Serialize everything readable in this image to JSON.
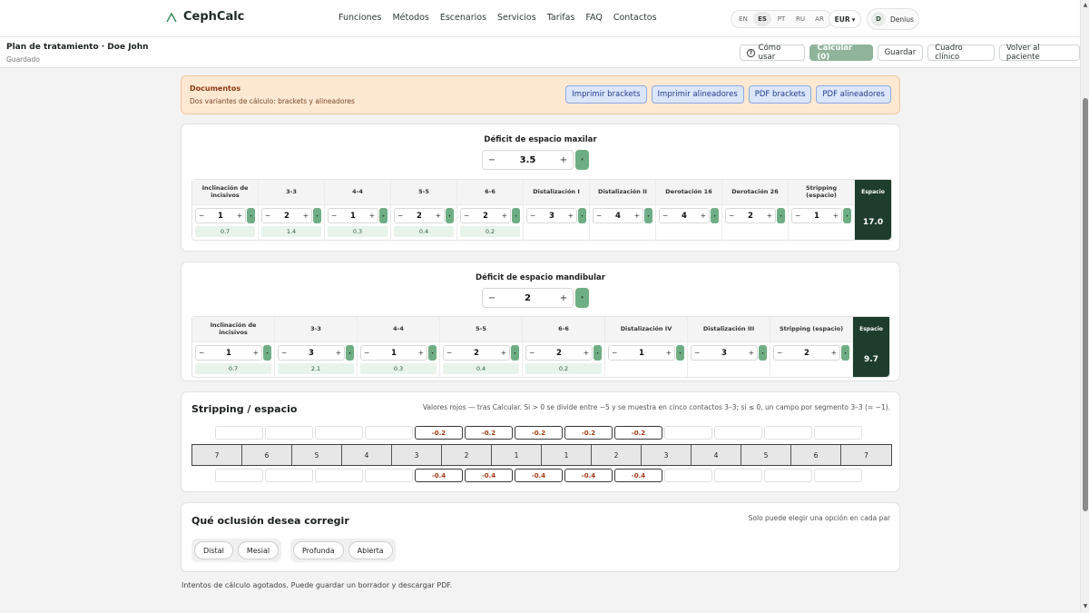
{
  "app": {
    "brand": "CephCalc"
  },
  "nav": [
    "Funciones",
    "Métodos",
    "Escenarios",
    "Servicios",
    "Tarifas",
    "FAQ",
    "Contactos"
  ],
  "languages": [
    "EN",
    "ES",
    "PT",
    "RU",
    "AR"
  ],
  "active_language": "ES",
  "currency": "EUR",
  "user": {
    "initial": "D",
    "name": "Denius"
  },
  "plan": {
    "title": "Plan de tratamiento · Doe John",
    "status": "Guardado"
  },
  "actions": {
    "how": "Cómo usar",
    "calc": "Calcular (0)",
    "save": "Guardar",
    "clinical": "Cuadro clínico",
    "back": "Volver al paciente"
  },
  "documents": {
    "title": "Documentos",
    "subtitle": "Dos variantes de cálculo: brackets y alineadores",
    "buttons": [
      "Imprimir brackets",
      "Imprimir alineadores",
      "PDF brackets",
      "PDF alineadores"
    ]
  },
  "maxilar": {
    "title": "Déficit de espacio maxilar",
    "value": "3.5",
    "columns": [
      {
        "label": "Inclinación de incisivos",
        "value": "1",
        "chip": "0.7"
      },
      {
        "label": "3-3",
        "value": "2",
        "chip": "1.4"
      },
      {
        "label": "4-4",
        "value": "1",
        "chip": "0.3"
      },
      {
        "label": "5-5",
        "value": "2",
        "chip": "0.4"
      },
      {
        "label": "6-6",
        "value": "2",
        "chip": "0.2"
      },
      {
        "label": "Distalización I",
        "value": "3",
        "chip": ""
      },
      {
        "label": "Distalización II",
        "value": "4",
        "chip": ""
      },
      {
        "label": "Derotación 16",
        "value": "4",
        "chip": ""
      },
      {
        "label": "Derotación 26",
        "value": "2",
        "chip": ""
      },
      {
        "label": "Stripping (espacio)",
        "value": "1",
        "chip": ""
      }
    ],
    "space_label": "Espacio",
    "space_value": "17.0"
  },
  "mandibular": {
    "title": "Déficit de espacio mandibular",
    "value": "2",
    "columns": [
      {
        "label": "Inclinación de incisivos",
        "value": "1",
        "chip": "0.7"
      },
      {
        "label": "3-3",
        "value": "3",
        "chip": "2.1"
      },
      {
        "label": "4-4",
        "value": "1",
        "chip": "0.3"
      },
      {
        "label": "5-5",
        "value": "2",
        "chip": "0.4"
      },
      {
        "label": "6-6",
        "value": "2",
        "chip": "0.2"
      },
      {
        "label": "Distalización IV",
        "value": "1",
        "chip": ""
      },
      {
        "label": "Distalización III",
        "value": "3",
        "chip": ""
      },
      {
        "label": "Stripping (espacio)",
        "value": "2",
        "chip": ""
      }
    ],
    "space_label": "Espacio",
    "space_value": "9.7"
  },
  "stripping": {
    "title": "Stripping / espacio",
    "note": "Valores rojos — tras Calcular. Si > 0 se divide entre −5 y se muestra en cinco contactos 3–3; si ≤ 0, un campo por segmento 3–3 (= −1).",
    "upper": [
      "",
      "",
      "",
      "",
      "-0.2",
      "-0.2",
      "-0.2",
      "-0.2",
      "-0.2",
      "",
      "",
      "",
      ""
    ],
    "teeth": [
      "7",
      "6",
      "5",
      "4",
      "3",
      "2",
      "1",
      "1",
      "2",
      "3",
      "4",
      "5",
      "6",
      "7"
    ],
    "lower": [
      "",
      "",
      "",
      "",
      "-0.4",
      "-0.4",
      "-0.4",
      "-0.4",
      "-0.4",
      "",
      "",
      "",
      ""
    ]
  },
  "occlusion": {
    "title": "Qué oclusión desea corregir",
    "note": "Solo puede elegir una opción en cada par",
    "group1": [
      "Distal",
      "Mesial"
    ],
    "group2": [
      "Profunda",
      "Abierta"
    ]
  },
  "footer": "Intentos de cálculo agotados. Puede guardar un borrador y descargar PDF."
}
